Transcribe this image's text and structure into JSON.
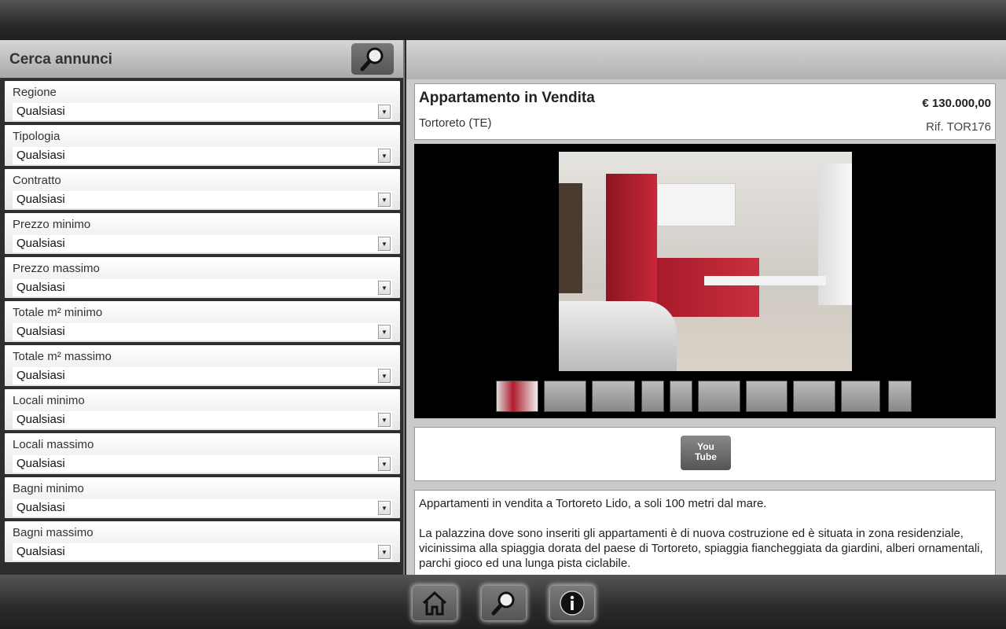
{
  "sidebar": {
    "title": "Cerca annunci",
    "filters": [
      {
        "label": "Regione",
        "value": "Qualsiasi"
      },
      {
        "label": "Tipologia",
        "value": "Qualsiasi"
      },
      {
        "label": "Contratto",
        "value": "Qualsiasi"
      },
      {
        "label": "Prezzo minimo",
        "value": "Qualsiasi"
      },
      {
        "label": "Prezzo massimo",
        "value": "Qualsiasi"
      },
      {
        "label": "Totale m² minimo",
        "value": "Qualsiasi"
      },
      {
        "label": "Totale m² massimo",
        "value": "Qualsiasi"
      },
      {
        "label": "Locali minimo",
        "value": "Qualsiasi"
      },
      {
        "label": "Locali massimo",
        "value": "Qualsiasi"
      },
      {
        "label": "Bagni minimo",
        "value": "Qualsiasi"
      },
      {
        "label": "Bagni massimo",
        "value": "Qualsiasi"
      }
    ]
  },
  "listing": {
    "title": "Appartamento in Vendita",
    "location": "Tortoreto (TE)",
    "price": "€ 130.000,00",
    "ref": "Rif. TOR176",
    "thumbnail_count": 10,
    "youtube": {
      "line1": "You",
      "line2": "Tube"
    },
    "description": [
      "Appartamenti in vendita a Tortoreto Lido, a soli 100 metri dal mare.",
      "La palazzina dove sono inseriti gli appartamenti è di nuova costruzione ed è situata in zona residenziale, vicinissima alla spiaggia dorata del paese di Tortoreto, spiaggia fiancheggiata da giardini, alberi ornamentali, parchi gioco ed una lunga pista ciclabile."
    ]
  },
  "nav": {
    "icons": [
      "home-icon",
      "search-icon",
      "info-icon"
    ]
  },
  "colors": {
    "accent": "#b01c2e"
  }
}
